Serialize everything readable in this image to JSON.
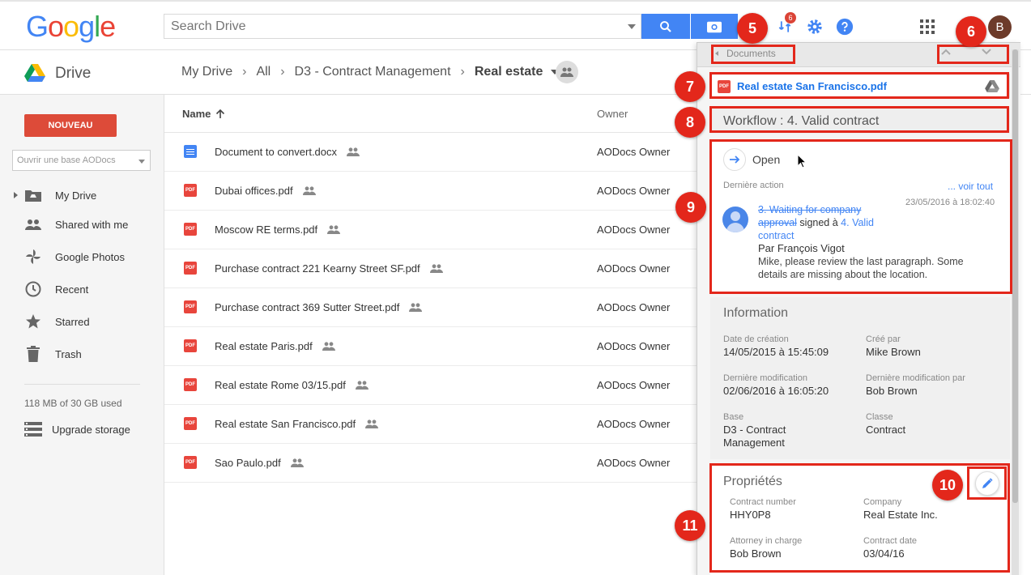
{
  "header": {
    "logo_letters": [
      "G",
      "o",
      "o",
      "g",
      "l",
      "e"
    ],
    "search_placeholder": "Search Drive",
    "notification_count": "6",
    "avatar_letter": "B"
  },
  "subbar": {
    "app_name": "Drive",
    "breadcrumb": [
      "My Drive",
      "All",
      "D3 - Contract Management",
      "Real estate"
    ]
  },
  "sidebar": {
    "new_label": "NOUVEAU",
    "base_placeholder": "Ouvrir une base AODocs",
    "items": [
      {
        "label": "My Drive",
        "icon": "drive-folder-icon"
      },
      {
        "label": "Shared with me",
        "icon": "people-icon"
      },
      {
        "label": "Google Photos",
        "icon": "pinwheel-icon"
      },
      {
        "label": "Recent",
        "icon": "clock-icon"
      },
      {
        "label": "Starred",
        "icon": "star-icon"
      },
      {
        "label": "Trash",
        "icon": "trash-icon"
      }
    ],
    "storage": "118 MB of 30 GB used",
    "upgrade_label": "Upgrade storage"
  },
  "list": {
    "col_name": "Name",
    "col_owner": "Owner",
    "rows": [
      {
        "name": "Document to convert.docx",
        "type": "doc",
        "owner": "AODocs Owner"
      },
      {
        "name": "Dubai offices.pdf",
        "type": "pdf",
        "owner": "AODocs Owner"
      },
      {
        "name": "Moscow RE terms.pdf",
        "type": "pdf",
        "owner": "AODocs Owner"
      },
      {
        "name": "Purchase contract 221 Kearny Street SF.pdf",
        "type": "pdf",
        "owner": "AODocs Owner"
      },
      {
        "name": "Purchase contract 369 Sutter Street.pdf",
        "type": "pdf",
        "owner": "AODocs Owner"
      },
      {
        "name": "Real estate Paris.pdf",
        "type": "pdf",
        "owner": "AODocs Owner"
      },
      {
        "name": "Real estate Rome 03/15.pdf",
        "type": "pdf",
        "owner": "AODocs Owner"
      },
      {
        "name": "Real estate San Francisco.pdf",
        "type": "pdf",
        "owner": "AODocs Owner"
      },
      {
        "name": "Sao Paulo.pdf",
        "type": "pdf",
        "owner": "AODocs Owner"
      }
    ]
  },
  "panel": {
    "back_label": "Documents",
    "file_name": "Real estate San Francisco.pdf",
    "workflow": "Workflow : 4. Valid contract",
    "open_label": "Open",
    "last_action_label": "Dernière action",
    "see_all": "... voir tout",
    "action_date": "23/05/2016 à 18:02:40",
    "from_state_1": "3. Waiting for company",
    "from_state_2": "approval",
    "signed_text": " signed à ",
    "to_state_1": "4. Valid",
    "to_state_2": "contract",
    "by": "Par François Vigot",
    "comment_1": "Mike, please review the last paragraph. Some",
    "comment_2": "details are missing about the location.",
    "info_title": "Information",
    "info": {
      "created_label": "Date de création",
      "created": "14/05/2015 à 15:45:09",
      "created_by_label": "Créé par",
      "created_by": "Mike Brown",
      "modified_label": "Dernière modification",
      "modified": "02/06/2016 à 16:05:20",
      "modified_by_label": "Dernière modification par",
      "modified_by": "Bob Brown",
      "base_label": "Base",
      "base_1": "D3 - Contract",
      "base_2": "Management",
      "class_label": "Classe",
      "class": "Contract"
    },
    "props_title": "Propriétés",
    "props": {
      "contract_number_label": "Contract number",
      "contract_number": "HHY0P8",
      "company_label": "Company",
      "company": "Real Estate Inc.",
      "attorney_label": "Attorney in charge",
      "attorney": "Bob Brown",
      "contract_date_label": "Contract date",
      "contract_date": "03/04/16"
    }
  },
  "annotations": [
    "5",
    "6",
    "7",
    "8",
    "9",
    "10",
    "11"
  ],
  "colors": {
    "accent": "#4285f4",
    "new_button": "#dd4b39",
    "annotation": "#e3271b"
  }
}
